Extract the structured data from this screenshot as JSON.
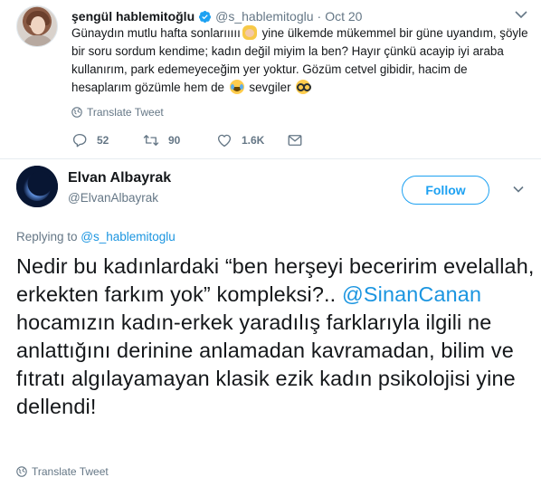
{
  "parent_tweet": {
    "display_name": "şengül hablemitoğlu",
    "handle": "@s_hablemitoglu",
    "separator": "·",
    "date": "Oct 20",
    "text_part1": "Günaydın mutlu hafta sonlarııııı",
    "emoji1": "woman-gesturing-emoji",
    "text_part2": " yine ülkemde mükemmel bir güne uyandım, şöyle bir soru sordum kendime; kadın değil miyim la ben? Hayır çünkü acayip iyi araba kullanırım, park edemeyeceğim yer yoktur. Gözüm cetvel gibidir, hacim de hesaplarım gözümle hem de ",
    "emoji2": "tears-of-joy-emoji",
    "text_part3": " sevgiler ",
    "emoji3": "nerd-face-emoji",
    "translate_label": "Translate Tweet",
    "counts": {
      "replies": "52",
      "retweets": "90",
      "likes": "1.6K"
    }
  },
  "main_tweet": {
    "display_name": "Elvan Albayrak",
    "handle": "@ElvanAlbayrak",
    "follow_label": "Follow",
    "replying_prefix": "Replying to ",
    "replying_handle": "@s_hablemitoglu",
    "text_part1": "Nedir bu kadınlardaki “ben herşeyi beceririm evelallah, erkekten farkım yok” kompleksi?.. ",
    "mention": "@SinanCanan",
    "text_part2": " hocamızın kadın-erkek yaradılış farklarıyla ilgili ne anlattığını derinine anlamadan kavramadan, bilim ve fıtratı algılayamayan klasik ezik kadın psikolojisi yine dellendi!",
    "translate_label": "Translate Tweet"
  },
  "colors": {
    "accent": "#1da1f2",
    "link": "#1b95e0",
    "muted": "#657786",
    "text": "#14171a",
    "divider": "#e6ecf0"
  }
}
